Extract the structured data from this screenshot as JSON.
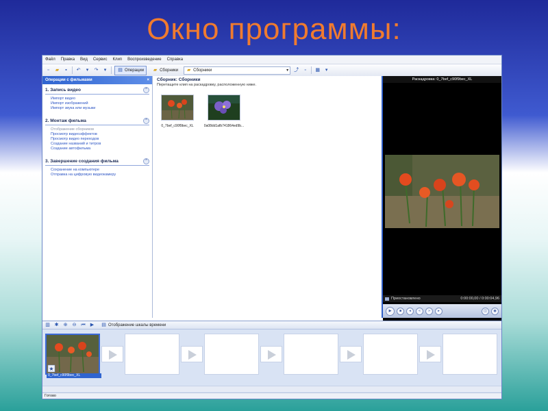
{
  "slide": {
    "title": "Окно программы:"
  },
  "menu": [
    "Файл",
    "Правка",
    "Вид",
    "Сервис",
    "Клип",
    "Воспроизведение",
    "Справка"
  ],
  "toolbar": {
    "operations_label": "Операции",
    "collections_label": "Сборники",
    "collection_select": "Сборники"
  },
  "tasks": {
    "header": "Операции с фильмами",
    "close": "×",
    "sections": [
      {
        "title": "1. Запись видео",
        "links": [
          "Импорт видео",
          "Импорт изображений",
          "Импорт звука или музыки"
        ]
      },
      {
        "title": "2. Монтаж фильма",
        "links": [
          "Отображение сборников",
          "Просмотр видеоэффектов",
          "Просмотр видео переходов",
          "Создание названий и титров",
          "Создание автофильма"
        ]
      },
      {
        "title": "3. Завершение создания фильма",
        "links": [
          "Сохранение на компьютере",
          "Отправка на цифровую видеокамеру"
        ]
      }
    ]
  },
  "collection": {
    "title": "Сборник: Сборники",
    "subtitle": "Перетащите клип на раскадровку, расположенную ниже.",
    "clips": [
      {
        "caption": "0_7bef_c90f9bec_XL"
      },
      {
        "caption": "0a08dd1afb741864ed9b..."
      }
    ]
  },
  "preview": {
    "title": "Раскадровка: 0_7bef_c90f9bec_XL",
    "status": "Приостановлено",
    "time": "0:00:00,00 / 0:00:04,96"
  },
  "storyboard": {
    "toggle_label": "Отображение шкалы времени",
    "first_caption": "0_7bef_c90f9bec_XL"
  },
  "statusbar": {
    "text": "Готово"
  }
}
